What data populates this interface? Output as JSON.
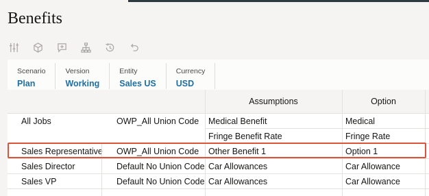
{
  "page": {
    "title": "Benefits"
  },
  "toolbar": {
    "tools": [
      "sliders-icon",
      "cube-icon",
      "add-comment-icon",
      "hierarchy-icon",
      "history-icon",
      "undo-icon"
    ]
  },
  "pov": [
    {
      "label": "Scenario",
      "value": "Plan"
    },
    {
      "label": "Version",
      "value": "Working"
    },
    {
      "label": "Entity",
      "value": "Sales US"
    },
    {
      "label": "Currency",
      "value": "USD"
    }
  ],
  "grid": {
    "headers": {
      "assumptions": "Assumptions",
      "option": "Option"
    },
    "rows": [
      {
        "job": "All Jobs",
        "union": "OWP_All Union Code",
        "assumption": "Medical Benefit",
        "option": "Medical"
      },
      {
        "job": "",
        "union": "",
        "assumption": "Fringe Benefit Rate",
        "option": "Fringe Rate"
      },
      {
        "job": "Sales Representative",
        "union": "OWP_All Union Code",
        "assumption": "Other Benefit 1",
        "option": "Option 1"
      },
      {
        "job": "Sales Director",
        "union": "Default No Union Code",
        "assumption": "Car Allowances",
        "option": "Car Allowance"
      },
      {
        "job": "Sales VP",
        "union": "Default No Union Code",
        "assumption": "Car Allowances",
        "option": "Car Allowance"
      }
    ]
  },
  "colors": {
    "accent": "#1d6fa5",
    "highlight": "#d9543a"
  }
}
